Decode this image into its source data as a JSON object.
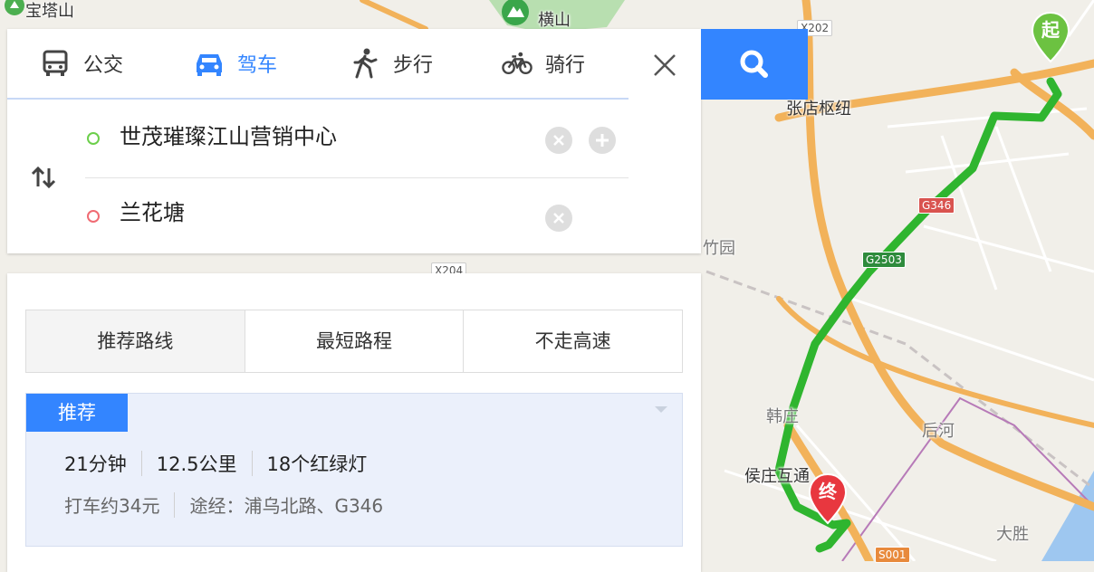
{
  "map": {
    "labels": {
      "baotashan": "宝塔山",
      "hengshan": "横山",
      "zhangdian": "张店枢纽",
      "zhuyuan": "竹园",
      "hanzhuang": "韩庄",
      "houhe": "后河",
      "houzhuang": "侯庄互通",
      "dasheng": "大胜"
    },
    "shields": {
      "x202": "X202",
      "g346": "G346",
      "g2503": "G2503",
      "x204": "X204",
      "s001": "S001"
    },
    "start_pin": "起",
    "end_pin": "终",
    "colors": {
      "route": "#2fb52f",
      "start_pin": "#6cc241",
      "end_pin": "#e8373f",
      "highway": "#f2b25a",
      "road": "#ffffff",
      "water": "#9ec7f0",
      "park": "#b8dfb0"
    }
  },
  "modes": [
    {
      "label": "公交",
      "icon": "bus-icon"
    },
    {
      "label": "驾车",
      "icon": "car-icon"
    },
    {
      "label": "步行",
      "icon": "walk-icon"
    },
    {
      "label": "骑行",
      "icon": "bike-icon"
    }
  ],
  "active_mode": "驾车",
  "start_place": "世茂璀璨江山营销中心",
  "end_place": "兰花塘",
  "preferences": [
    "推荐路线",
    "最短路程",
    "不走高速"
  ],
  "active_preference": "推荐路线",
  "route": {
    "badge": "推荐",
    "duration": "21分钟",
    "distance": "12.5公里",
    "lights": "18个红绿灯",
    "taxi": "打车约34元",
    "via": "途经：浦乌北路、G346"
  },
  "accent": "#3385ff"
}
